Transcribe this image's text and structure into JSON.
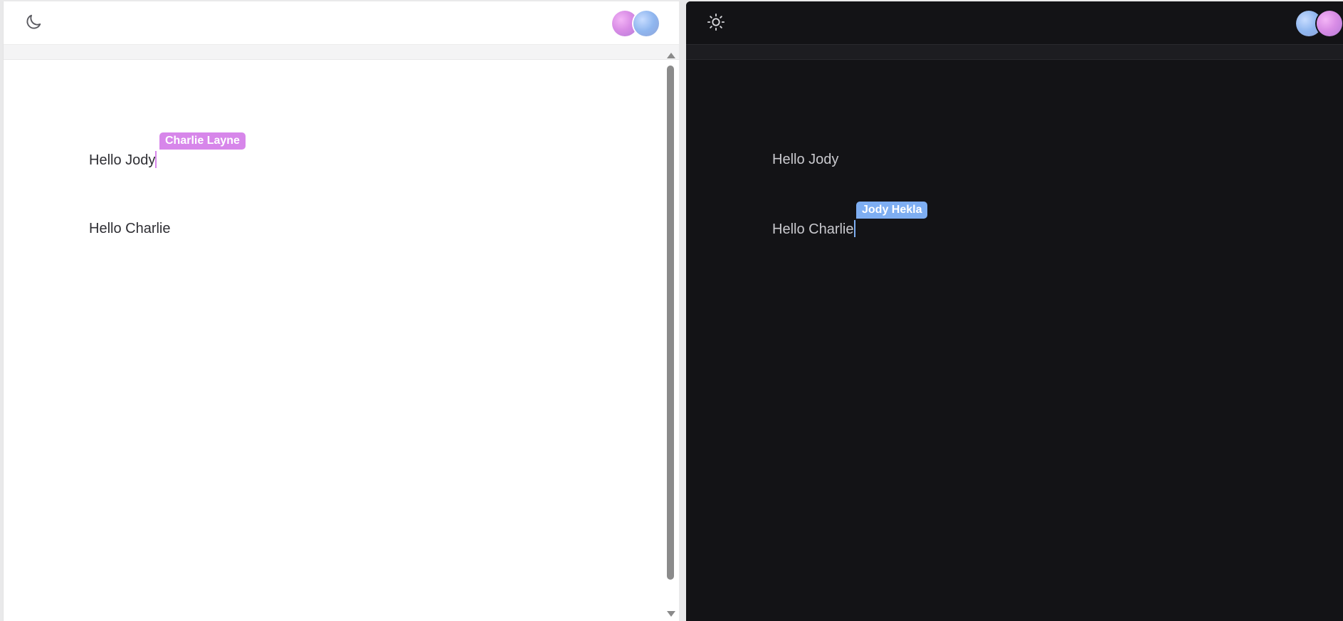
{
  "left_pane": {
    "theme": "light",
    "theme_toggle_icon": "moon-icon",
    "avatars": [
      {
        "user": "Charlie Layne",
        "color": "#d98de6"
      },
      {
        "user": "Jody Hekla",
        "color": "#8fb6ef"
      }
    ],
    "paragraphs": [
      "Hello Jody",
      "Hello Charlie"
    ],
    "remote_cursor": {
      "user": "Charlie Layne",
      "color": "#d786ea"
    }
  },
  "right_pane": {
    "theme": "dark",
    "theme_toggle_icon": "sun-icon",
    "avatars": [
      {
        "user": "Jody Hekla",
        "color": "#8fb6ef"
      },
      {
        "user": "Charlie Layne",
        "color": "#d98de6"
      }
    ],
    "paragraphs": [
      "Hello Jody",
      "Hello Charlie"
    ],
    "remote_cursor": {
      "user": "Jody Hekla",
      "color": "#7eaef2"
    }
  }
}
